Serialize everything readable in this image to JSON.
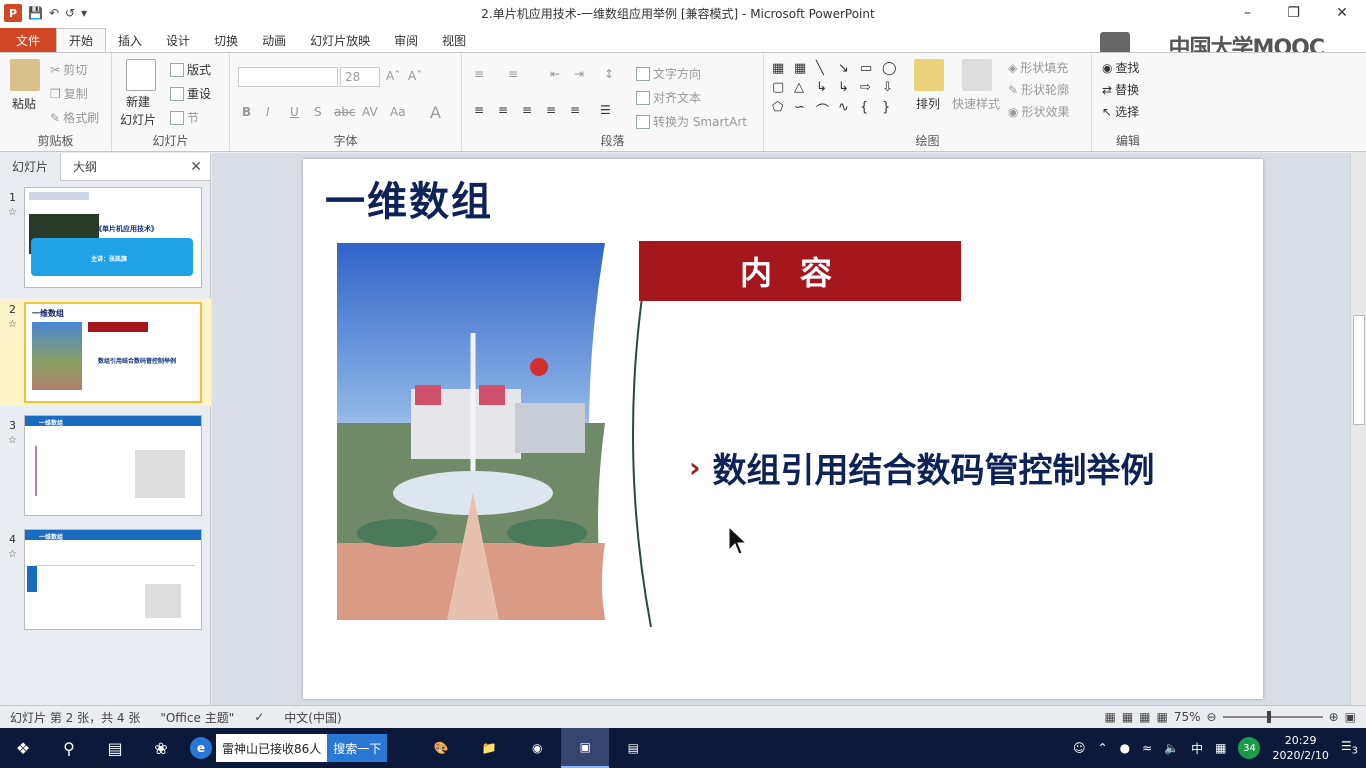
{
  "window": {
    "title": "2.单片机应用技术-一维数组应用举例 [兼容模式] - Microsoft PowerPoint",
    "app_icon": "P",
    "controls": [
      "–",
      "❐",
      "✕"
    ]
  },
  "ribbon_tabs": [
    "文件",
    "开始",
    "插入",
    "设计",
    "切换",
    "动画",
    "幻灯片放映",
    "审阅",
    "视图"
  ],
  "ribbon": {
    "clipboard": {
      "paste": "粘贴",
      "cut": "剪切",
      "copy": "复制",
      "format_painter": "格式刷",
      "label": "剪贴板"
    },
    "slides": {
      "new_slide": "新建",
      "new_slide2": "幻灯片",
      "layout": "版式",
      "reset": "重设",
      "section": "节",
      "label": "幻灯片"
    },
    "font": {
      "size": "28",
      "label": "字体"
    },
    "paragraph": {
      "text_direction": "文字方向",
      "align_text": "对齐文本",
      "smartart": "转换为 SmartArt",
      "label": "段落"
    },
    "drawing": {
      "arrange": "排列",
      "quick_styles": "快速样式",
      "fill": "形状填充",
      "outline": "形状轮廓",
      "effects": "形状效果",
      "label": "绘图"
    },
    "editing": {
      "find": "查找",
      "replace": "替换",
      "select": "选择",
      "label": "编辑"
    }
  },
  "watermark": "中国大学MOOC",
  "left_panel": {
    "tabs": [
      "幻灯片",
      "大纲"
    ],
    "close": "✕",
    "thumbnails": [
      {
        "num": "1",
        "title": "《单片机应用技术》",
        "sub": "主讲：张凯旗"
      },
      {
        "num": "2",
        "title": "一维数组",
        "sub": "数组引用结合数码管控制举例"
      },
      {
        "num": "3",
        "title": "一维数组",
        "sub": ""
      },
      {
        "num": "4",
        "title": "一维数组",
        "sub": ""
      }
    ]
  },
  "slide": {
    "title": "一维数组",
    "banner": "内容",
    "bullet": "数组引用结合数码管控制举例",
    "bullet_marker": "›"
  },
  "status": {
    "slide_info": "幻灯片 第 2 张，共 4 张",
    "theme": "\"Office 主题\"",
    "language": "中文(中国)",
    "zoom": "75%"
  },
  "taskbar": {
    "search_text": "雷神山已接收86人",
    "search_button": "搜索一下",
    "time": "20:29",
    "date": "2020/2/10",
    "badge": "34",
    "ime": "中",
    "notifications": "3"
  }
}
